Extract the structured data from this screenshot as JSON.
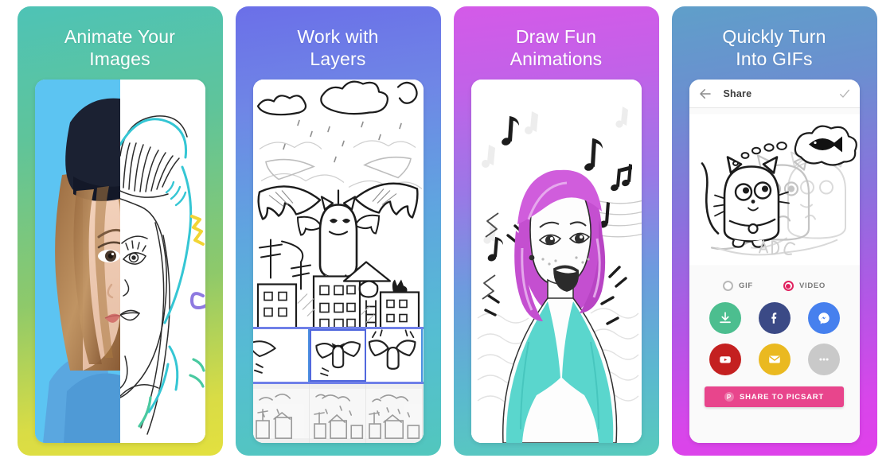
{
  "gallery": {
    "panels": [
      {
        "id": "animate-your-images",
        "title": "Animate Your\nImages",
        "gradient_from": "#4ec3b6",
        "gradient_to": "#e3e03f",
        "screen_type": "split-photo-drawing",
        "photo_background": "#5cc4f2"
      },
      {
        "id": "work-with-layers",
        "title": "Work with\nLayers",
        "gradient_from": "#6b6fe8",
        "gradient_to": "#52c7bd",
        "screen_type": "layers-timeline",
        "frames": [
          {
            "label": "frame-1",
            "selected": false
          },
          {
            "label": "frame-2",
            "selected": true
          },
          {
            "label": "frame-3",
            "selected": false
          }
        ],
        "layers": [
          {
            "label": "layer-1"
          },
          {
            "label": "layer-2"
          },
          {
            "label": "layer-3"
          }
        ]
      },
      {
        "id": "draw-fun-animations",
        "title": "Draw Fun\nAnimations",
        "gradient_from": "#d45ae8",
        "gradient_to": "#57cbbd",
        "screen_type": "singing-character",
        "hair_color": "#c44fd0",
        "shirt_color": "#5ad6cd"
      },
      {
        "id": "quickly-turn-into-gifs",
        "title": "Quickly Turn\nInto GIFs",
        "gradient_from": "#5f9fc9",
        "gradient_to": "#e040ea",
        "screen_type": "share-screen",
        "appbar": {
          "back_icon": "arrow-left-icon",
          "title": "Share",
          "confirm_icon": "check-icon"
        },
        "format_options": [
          {
            "label": "GIF",
            "selected": false
          },
          {
            "label": "VIDEO",
            "selected": true
          }
        ],
        "selected_color": "#e0225f",
        "share_targets": [
          {
            "name": "download",
            "icon": "download-icon",
            "color": "#4cbe8f"
          },
          {
            "name": "facebook",
            "icon": "facebook-icon",
            "color": "#3b4a86"
          },
          {
            "name": "messenger",
            "icon": "messenger-icon",
            "color": "#4680ee"
          },
          {
            "name": "youtube",
            "icon": "youtube-icon",
            "color": "#c42020"
          },
          {
            "name": "email",
            "icon": "envelope-icon",
            "color": "#eab920"
          },
          {
            "name": "more",
            "icon": "more-dots-icon",
            "color": "#c9c9c9"
          }
        ],
        "primary_button": {
          "logo": "P",
          "label": "SHARE TO PICSART",
          "color": "#e8458c"
        }
      }
    ]
  }
}
